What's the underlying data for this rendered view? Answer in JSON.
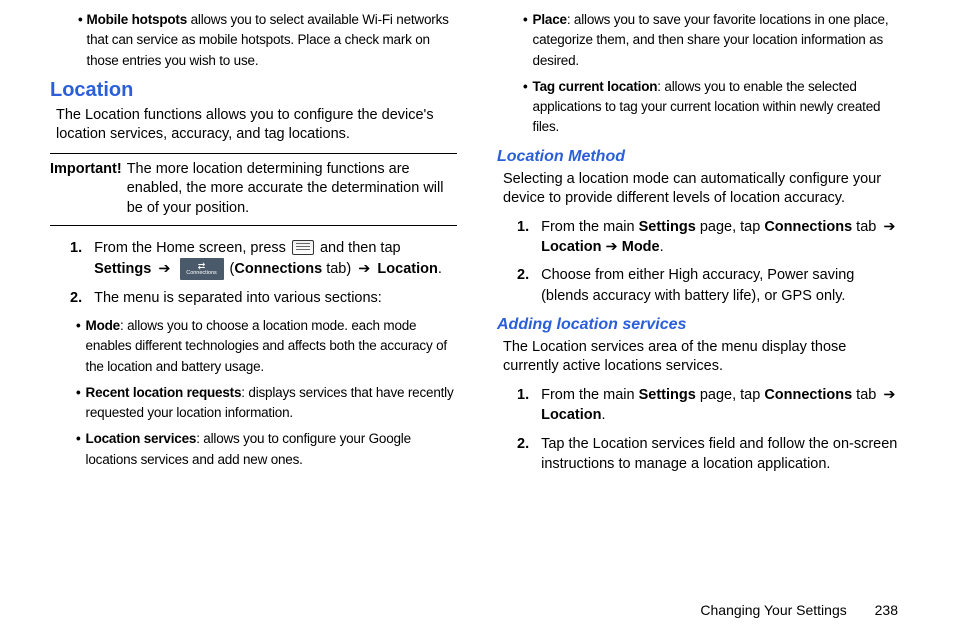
{
  "left": {
    "hotspot": {
      "label": "Mobile hotspots",
      "text": " allows you to select available Wi-Fi networks that can service as mobile hotspots. Place a check mark on those entries you wish to use."
    },
    "locationHeading": "Location",
    "locationDesc": "The Location functions allows you to configure the device's location services, accuracy, and tag locations.",
    "important": {
      "label": "Important!",
      "text": "The more location determining functions are enabled, the more accurate the determination will be of your position."
    },
    "step1": {
      "num": "1.",
      "pre": "From the Home screen, press ",
      "post1": " and then tap ",
      "settings": "Settings",
      "arrow1": "➔",
      "openParen": " (",
      "connections": "Connections",
      "tabText": " tab) ",
      "arrow2": "➔",
      "location": " Location",
      "period": "."
    },
    "step2": {
      "num": "2.",
      "text": "The menu is separated into various sections:"
    },
    "mode": {
      "label": "Mode",
      "text": ": allows you to choose a location mode. each mode enables different technologies and affects both the accuracy of the location and battery usage."
    },
    "recent": {
      "label": "Recent location requests",
      "text": ": displays services that have recently requested your location information."
    },
    "services": {
      "label": "Location services",
      "text": ": allows you to configure your Google locations services and add new ones."
    }
  },
  "right": {
    "place": {
      "label": "Place",
      "text": ": allows you to save your favorite locations in one place, categorize them, and then share your location information as desired."
    },
    "tag": {
      "label": "Tag current location",
      "text": ": allows you to enable the selected applications to tag your current location within newly created files."
    },
    "methodHeading": "Location Method",
    "methodDesc": "Selecting a location mode can automatically configure your device to provide different levels of location accuracy.",
    "m1": {
      "num": "1.",
      "pre": "From the main ",
      "settings": "Settings",
      "mid": " page, tap ",
      "connections": "Connections",
      "tab": " tab ",
      "arrow1": "➔",
      "location": " Location",
      "arrow2": " ➔ ",
      "mode": "Mode",
      "period": "."
    },
    "m2": {
      "num": "2.",
      "text": "Choose from either High accuracy, Power saving (blends accuracy with battery life), or GPS only."
    },
    "addingHeading": "Adding location services",
    "addingDesc": "The Location services area of the menu display those currently active locations services.",
    "a1": {
      "num": "1.",
      "pre": "From the main ",
      "settings": "Settings",
      "mid": " page, tap ",
      "connections": "Connections",
      "tab": " tab ",
      "arrow": "➔",
      "location": " Location",
      "period": "."
    },
    "a2": {
      "num": "2.",
      "text": "Tap the Location services field and follow the on-screen instructions to manage a location application."
    }
  },
  "footer": {
    "title": "Changing Your Settings",
    "page": "238"
  },
  "connectionsIconLabel": "Connections"
}
